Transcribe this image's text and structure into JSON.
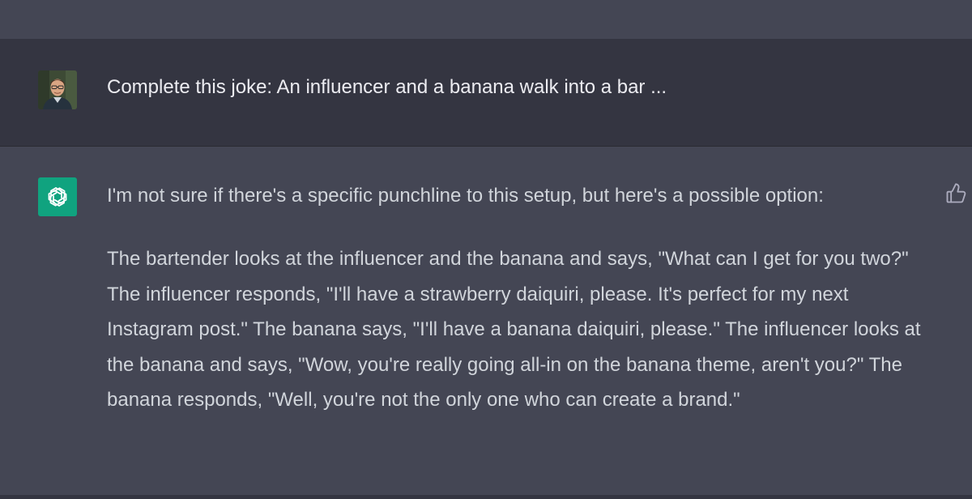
{
  "conversation": {
    "user_message": {
      "text": "Complete this joke: An influencer and a banana walk into a bar ..."
    },
    "assistant_message": {
      "paragraph_1": "I'm not sure if there's a specific punchline to this setup, but here's a possible option:",
      "paragraph_2": "The bartender looks at the influencer and the banana and says, \"What can I get for you two?\" The influencer responds, \"I'll have a strawberry daiquiri, please. It's perfect for my next Instagram post.\" The banana says, \"I'll have a banana daiquiri, please.\" The influencer looks at the banana and says, \"Wow, you're really going all-in on the banana theme, aren't you?\" The banana responds, \"Well, you're not the only one who can create a brand.\""
    }
  },
  "icons": {
    "user_avatar": "user-avatar",
    "assistant_avatar": "openai-logo-icon",
    "feedback": "thumbs-up-icon"
  },
  "colors": {
    "assistant_bg": "#444654",
    "user_bg": "#343541",
    "assistant_avatar_bg": "#10a37f",
    "text": "#ececf1"
  }
}
